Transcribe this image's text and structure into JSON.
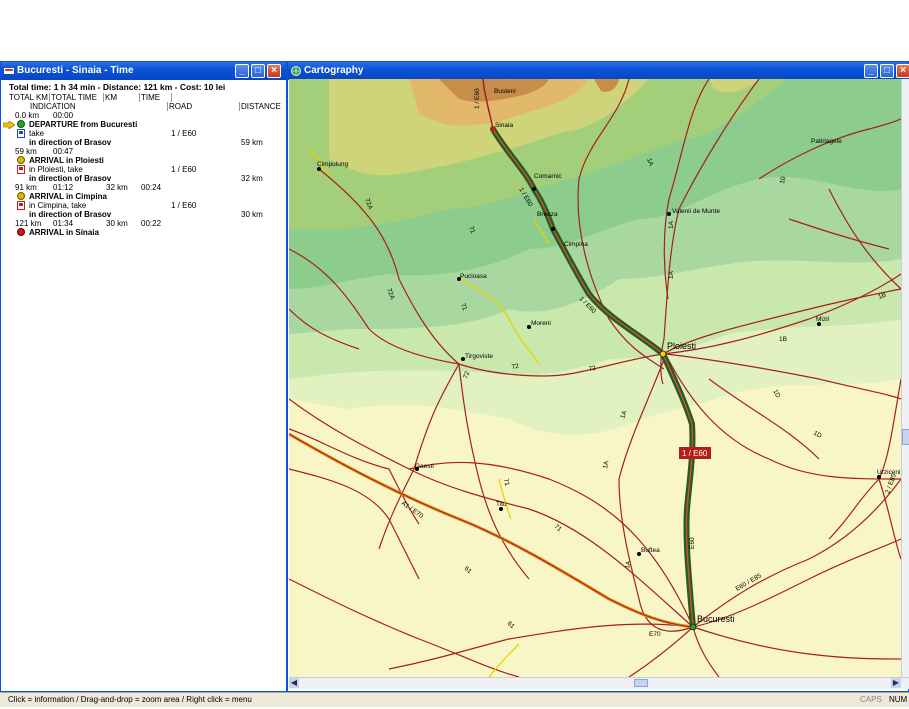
{
  "left_window": {
    "title": "Bucuresti - Sinaia - Time",
    "summary": "Total time: 1 h 34 min - Distance: 121 km - Cost: 10 lei",
    "headers_top": [
      "TOTAL KM",
      "TOTAL TIME",
      "KM",
      "TIME"
    ],
    "headers_bottom": [
      "INDICATION",
      "ROAD",
      "DISTANCE"
    ],
    "rows": [
      {
        "c1": "0.0 km",
        "c2": "00:00"
      },
      {
        "icon": "green",
        "text": "DEPARTURE from Bucuresti",
        "bold": true
      },
      {
        "icon": "car",
        "text": "take",
        "road": "1 / E60"
      },
      {
        "text": "in direction of Brasov",
        "bold": true,
        "dist": "59 km"
      },
      {
        "c1": "59 km",
        "c2": "00:47"
      },
      {
        "icon": "yellow",
        "text": "ARRIVAL in Ploiesti",
        "bold": true
      },
      {
        "icon": "car",
        "text": "in Ploiesti, take",
        "road": "1 / E60"
      },
      {
        "text": "in direction of Brasov",
        "bold": true,
        "dist": "32 km"
      },
      {
        "c1": "91 km",
        "c2": "01:12",
        "c3": "32 km",
        "c4": "00:24"
      },
      {
        "icon": "yellow",
        "text": "ARRIVAL in Cimpina",
        "bold": true
      },
      {
        "icon": "car",
        "text": "in Cimpina, take",
        "road": "1 / E60"
      },
      {
        "text": "in direction of Brasov",
        "bold": true,
        "dist": "30 km"
      },
      {
        "c1": "121 km",
        "c2": "01:34",
        "c3": "30 km",
        "c4": "00:22"
      },
      {
        "icon": "red",
        "text": "ARRIVAL in Sinaia",
        "bold": true
      }
    ]
  },
  "map_window": {
    "title": "Cartography",
    "cities": [
      "Busteni",
      "Sinaia",
      "Comarnic",
      "Breaza",
      "Cimpina",
      "Valenii de Munte",
      "Patirlagele",
      "Cimpulung",
      "Pucioasa",
      "Moreni",
      "Tirgoviste",
      "Ploiesti",
      "Mizil",
      "Gaesti",
      "Titu",
      "Buftea",
      "Bucuresti",
      "Urziceni"
    ],
    "roads": [
      "1 / E60",
      "1A",
      "1B",
      "1D",
      "10",
      "71",
      "72",
      "72A",
      "7",
      "61",
      "E60",
      "E70",
      "E85",
      "2 / E85",
      "A1 / E70",
      "E60 / E85",
      "1B"
    ],
    "highlight_label": "1 / E60"
  },
  "status": {
    "hint": "Click = information / Drag-and-drop = zoom area / Right click = menu",
    "caps": "CAPS",
    "num": "NUM"
  },
  "colors": {
    "titlebar": "#0a52d8",
    "route": "#2e7d32",
    "road": "#c0392b",
    "highlight_bg": "#b71c1c"
  }
}
